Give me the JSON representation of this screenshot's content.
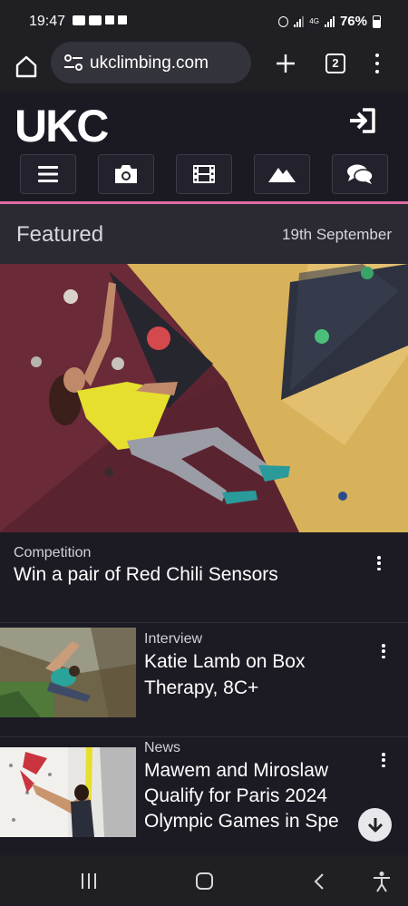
{
  "status_bar": {
    "time": "19:47",
    "network": "4G",
    "battery": "76%"
  },
  "browser": {
    "url": "ukclimbing.com",
    "tab_count": "2"
  },
  "site": {
    "logo": "UKC",
    "nav_icons": [
      "menu-icon",
      "camera-icon",
      "film-icon",
      "mountain-icon",
      "chat-icon"
    ]
  },
  "featured": {
    "title": "Featured",
    "date": "19th September"
  },
  "hero_article": {
    "category": "Competition",
    "title": "Win a pair of Red Chili Sensors"
  },
  "articles": [
    {
      "category": "Interview",
      "title_line1": "Katie Lamb on Box",
      "title_line2": "Therapy, 8C+"
    },
    {
      "category": "News",
      "title_line1": "Mawem and Miroslaw",
      "title_line2": "Qualify for Paris 2024",
      "title_line3": "Olympic Games in Spe"
    }
  ],
  "colors": {
    "accent_pink": "#e06aa6",
    "header_bg": "#1b1a23",
    "featured_bg": "#2b2a33"
  }
}
